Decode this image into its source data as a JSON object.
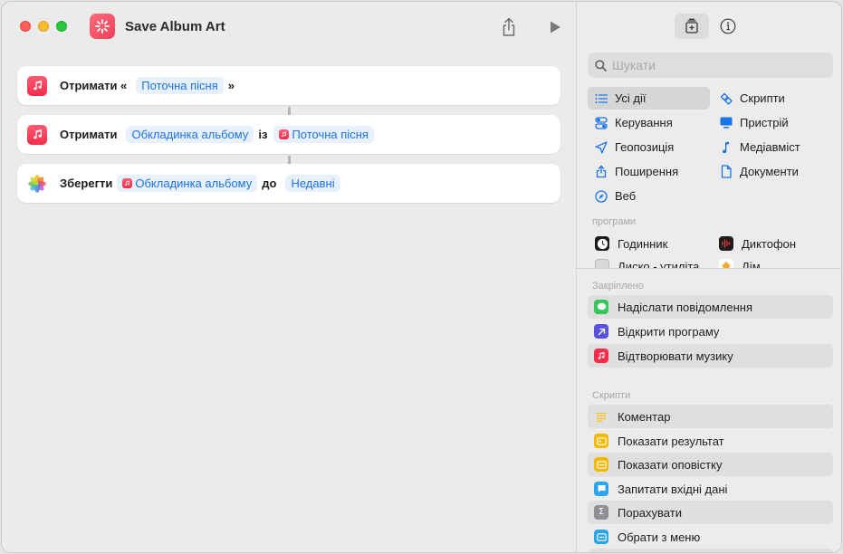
{
  "window": {
    "title": "Save Album Art"
  },
  "workflow": {
    "actions": [
      {
        "verb": "Отримати «",
        "token1": "Поточна пісня",
        "suffix": "»"
      },
      {
        "verb": "Отримати",
        "token1": "Обкладинка альбому",
        "joiner": "із",
        "token2": "Поточна пісня"
      },
      {
        "verb": "Зберегти",
        "token1": "Обкладинка альбому",
        "joiner": "до",
        "token2": "Недавні"
      }
    ]
  },
  "sidebar": {
    "search_placeholder": "Шукати",
    "categories_left": [
      "Усі дії",
      "Керування",
      "Геопозиція",
      "Поширення",
      "Веб"
    ],
    "categories_right": [
      "Скрипти",
      "Пристрій",
      "Медіавміст",
      "Документи"
    ],
    "apps_label": "програми",
    "apps": [
      "Годинник",
      "Диктофон",
      "Диско - утиліта",
      "Дім"
    ],
    "pinned_label": "Закріплено",
    "pinned": [
      "Надіслати повідомлення",
      "Відкрити програму",
      "Відтворювати музику"
    ],
    "scripts_label": "Скрипти",
    "scripts": [
      "Коментар",
      "Показати результат",
      "Показати оповістку",
      "Запитати вхідні дані",
      "Порахувати",
      "Обрати з меню"
    ]
  },
  "colors": {
    "accent": "#1a74e8",
    "music": "#f62c49"
  }
}
